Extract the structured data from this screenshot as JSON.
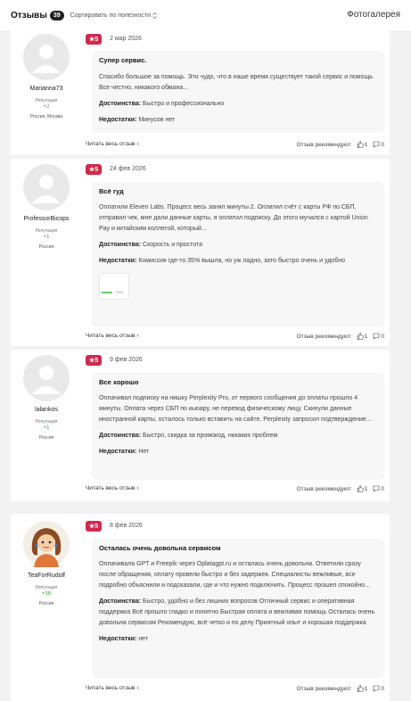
{
  "header": {
    "title": "Отзывы",
    "count": "39",
    "sort_label": "Сортировать по полезности",
    "gallery_label": "Фотогалерея"
  },
  "common": {
    "read_full": "Читать весь отзыв",
    "recommend": "Отзыв рекомендуют",
    "rep_label": "Репутация"
  },
  "reviews": [
    {
      "author": "Marianna73",
      "reputation": "+2",
      "location": "Россия, Москва",
      "rating": "5",
      "date": "2 мар 2026",
      "title": "Супер сервис.",
      "text": "Спасибо большое за помощь. Это чудо, что в наше время существует такой сервис и помощь. Все честно, никакого обмана...",
      "pros_label": "Достоинства:",
      "pros": "Быстро и профессионально",
      "cons_label": "Недостатки:",
      "cons": "Минусов нет",
      "likes": "1",
      "comments": "0"
    },
    {
      "author": "ProfessorBicops",
      "reputation": "+1",
      "location": "Россия",
      "rating": "5",
      "date": "24 фев 2026",
      "title": "Всё гуд",
      "text": "Оплатили Eleven Labs. Процесс весь занял минуты 2. Оплатил счёт с карты РФ по СБП, отправил чек, мне дали данные карты, я оплатил подписку. До этого мучался с картой Union Pay и китайским коллегой, который...",
      "pros_label": "Достоинства:",
      "pros": "Скорость и простота",
      "cons_label": "Недостатки:",
      "cons": "Комиссия где-то 35% вышла, но уж ладно, зато быстро очень и удобно",
      "thumb_text": "Paid",
      "likes": "1",
      "comments": "0"
    },
    {
      "author": "lalankos",
      "reputation": "+1",
      "location": "Россия",
      "rating": "5",
      "date": "9 фев 2026",
      "title": "Все хорошо",
      "text": "Оплачивал подписку на нишку Perplexity Pro, от первого сообщения до оплаты прошло 4 минуты. Оплата через СБП по кьюару, не перевод физическому лицу. Скинули данные иностранной карты, осталось только вставить на сайте. Perplexity запросил подтверждение...",
      "pros_label": "Достоинства:",
      "pros": "Быстро, скидка за промокод, никаких проблем",
      "cons_label": "Недостатки:",
      "cons": "Нет",
      "likes": "1",
      "comments": "0"
    },
    {
      "author": "TeaForRudolf",
      "reputation": "+38",
      "location": "Россия",
      "rating": "5",
      "date": "8 фев 2026",
      "title": "Осталась очень довольна сервисом",
      "text": "Оплачивала GPT и Freepik через Oplatagpt.ru и осталась очень довольна. Ответили сразу после обращения, оплату провели быстро и без задержек. Специалисты вежливые, все подробно объяснили и подсказали, где и что нужно подключить. Процесс прошел спокойно...",
      "pros_label": "Достоинства:",
      "pros": "Быстро, удобно и без лишних вопросов Отличный сервис и оперативная поддержка Всё прошло гладко и понятно Быстрая оплата и вежливая помощь Осталась очень довольна сервисом Рекомендую, всё четко и по делу Приятный опыт и хорошая поддержка",
      "cons_label": "Недостатки:",
      "cons": "нет",
      "likes": "1",
      "comments": "0"
    }
  ],
  "colors": {
    "rating_badge": "#d0294b",
    "reputation": "#4aa24a"
  }
}
